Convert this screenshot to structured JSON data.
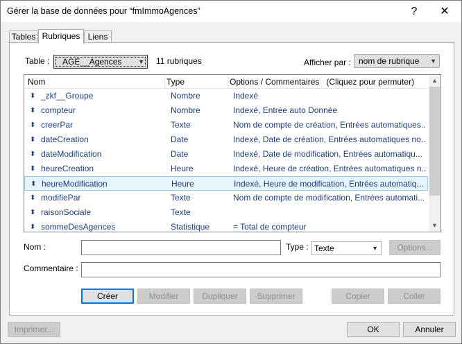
{
  "window": {
    "title": "Gérer la base de données pour “fmImmoAgences”",
    "help_glyph": "?",
    "close_glyph": "✕"
  },
  "tabs": [
    {
      "label": "Tables",
      "active": false
    },
    {
      "label": "Rubriques",
      "active": true
    },
    {
      "label": "Liens",
      "active": false
    }
  ],
  "table_select": {
    "label": "Table :",
    "value": "AGE__Agences",
    "count_text": "11 rubriques"
  },
  "view_by": {
    "label": "Afficher par :",
    "value": "nom de rubrique"
  },
  "list": {
    "columns": [
      "Nom",
      "Type",
      "Options / Commentaires   (Cliquez pour permuter)"
    ],
    "rows": [
      {
        "name": "_zkf__Groupe",
        "type": "Nombre",
        "options": "Indexé"
      },
      {
        "name": "compteur",
        "type": "Nombre",
        "options": "Indexé, Entrée auto Donnée"
      },
      {
        "name": "creerPar",
        "type": "Texte",
        "options": "Nom de compte de création, Entrées automatiques..."
      },
      {
        "name": "dateCreation",
        "type": "Date",
        "options": "Indexé, Date de création, Entrées automatiques no..."
      },
      {
        "name": "dateModification",
        "type": "Date",
        "options": "Indexé, Date de modification, Entrées automatiqu..."
      },
      {
        "name": "heureCreation",
        "type": "Heure",
        "options": "Indexé, Heure de création, Entrées automatiques n..."
      },
      {
        "name": "heureModification",
        "type": "Heure",
        "options": "Indexé, Heure de modification, Entrées automatiq...",
        "selected": true
      },
      {
        "name": "modifiePar",
        "type": "Texte",
        "options": "Nom de compte de modification, Entrées automati..."
      },
      {
        "name": "raisonSociale",
        "type": "Texte",
        "options": ""
      },
      {
        "name": "sommeDesAgences",
        "type": "Statistique",
        "options": "= Total de compteur"
      }
    ],
    "move_glyph": "⬍"
  },
  "form": {
    "name_label": "Nom :",
    "name_value": "",
    "type_label": "Type :",
    "type_value": "Texte",
    "options_button": "Options...",
    "comment_label": "Commentaire :",
    "comment_value": ""
  },
  "action_buttons": {
    "create": "Créer",
    "modify": "Modifier",
    "duplicate": "Dupliquer",
    "delete": "Supprimer",
    "copy": "Copier",
    "paste": "Coller"
  },
  "footer": {
    "print": "Imprimer...",
    "ok": "OK",
    "cancel": "Annuler"
  }
}
